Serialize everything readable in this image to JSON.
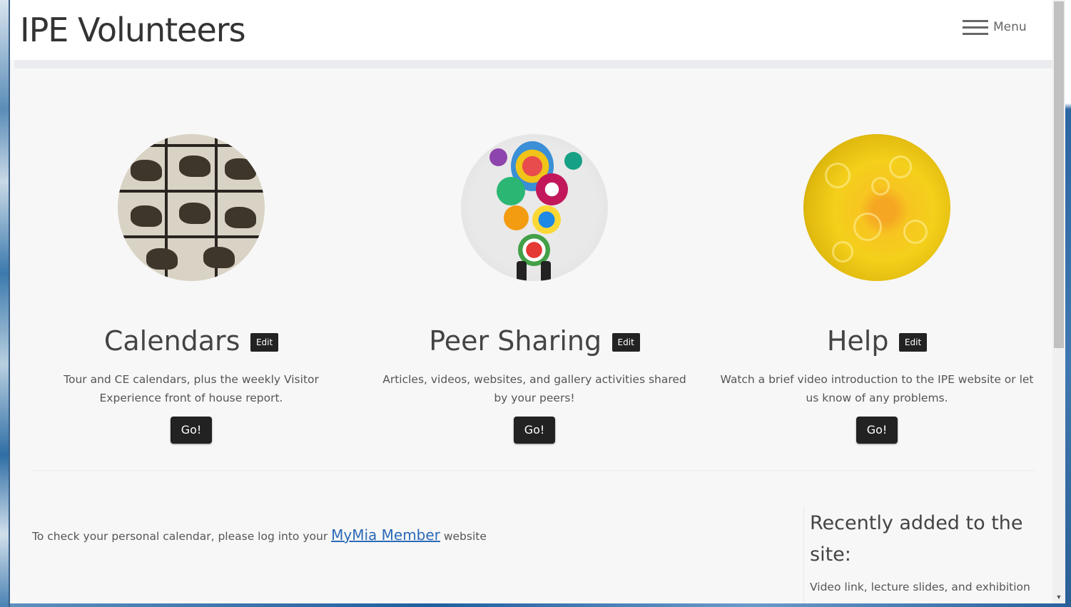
{
  "header": {
    "site_title": "IPE Volunteers",
    "menu_label": "Menu"
  },
  "cards": [
    {
      "title": "Calendars",
      "edit_label": "Edit",
      "description": "Tour and CE calendars, plus the weekly Visitor Experience front of house report.",
      "button_label": "Go!",
      "image": "horse-motion-study-photo"
    },
    {
      "title": "Peer Sharing",
      "edit_label": "Edit",
      "description": "Articles, videos, websites, and gallery activities shared by your peers!",
      "button_label": "Go!",
      "image": "colorful-rosette-sculpture-photo"
    },
    {
      "title": "Help",
      "edit_label": "Edit",
      "description": "Watch a brief video introduction to the IPE website or let us know of any problems.",
      "button_label": "Go!",
      "image": "yellow-glass-sculpture-photo"
    }
  ],
  "personal_calendar": {
    "text_before": "To check your personal calendar, please log into your ",
    "link_text": "MyMia Member",
    "text_after": " website"
  },
  "sidebar": {
    "title": "Recently added to the site:",
    "snippet": "Video link, lecture slides, and exhibition"
  },
  "colors": {
    "page_background": "#f7f7f7",
    "button_background": "#222222",
    "link": "#2a6ab7"
  }
}
